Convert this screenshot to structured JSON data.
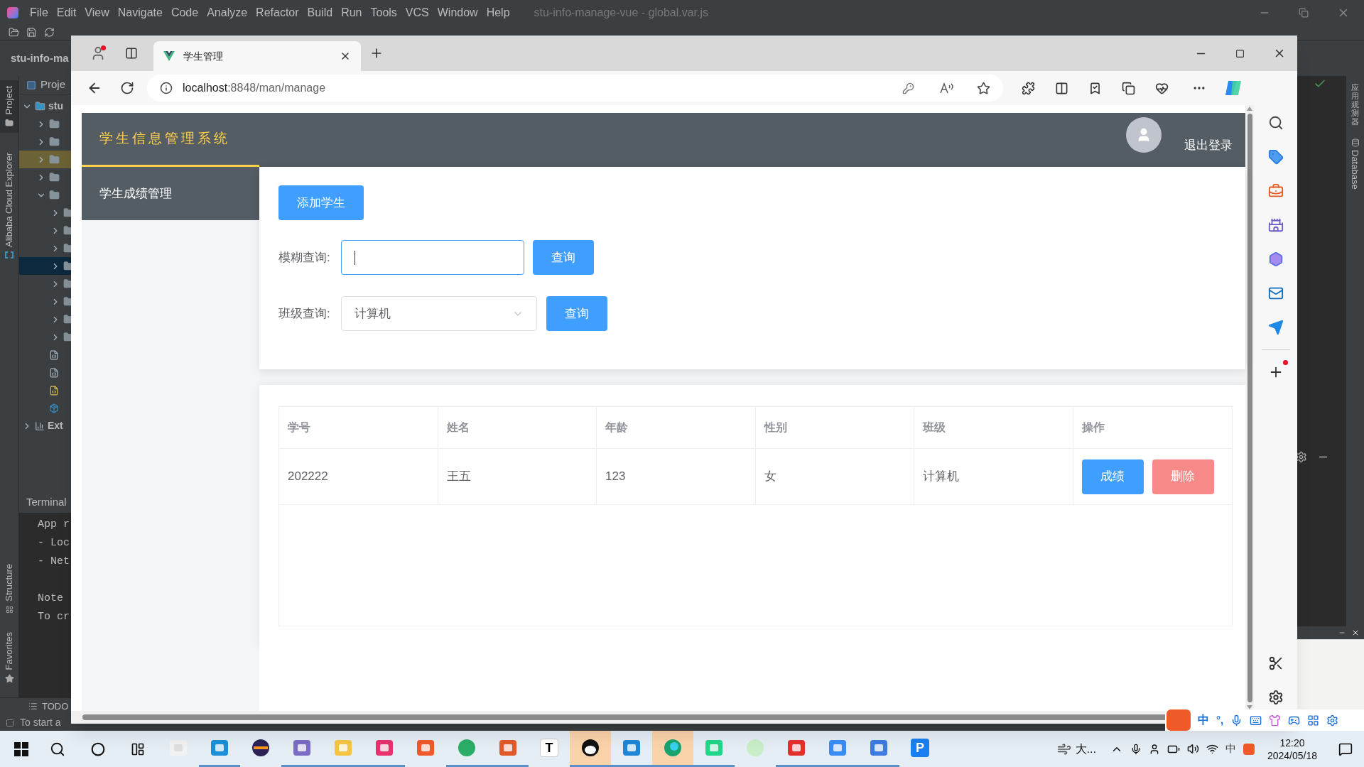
{
  "ide": {
    "menu": [
      "File",
      "Edit",
      "View",
      "Navigate",
      "Code",
      "Analyze",
      "Refactor",
      "Build",
      "Run",
      "Tools",
      "VCS",
      "Window",
      "Help"
    ],
    "title": "stu-info-manage-vue - global.var.js",
    "project_name": "stu-info-ma",
    "left_tools_top": [
      {
        "label": "Project",
        "selected": true
      },
      {
        "label": "Alibaba Cloud Explorer",
        "selected": false
      }
    ],
    "left_tools_bottom": [
      {
        "label": "Structure"
      },
      {
        "label": "Favorites"
      }
    ],
    "panel_title": "Proje",
    "tree": [
      {
        "label": "stu",
        "kind": "module",
        "expanded": true,
        "selected": false,
        "children": [
          {
            "kind": "folder",
            "expanded": false,
            "selected": false,
            "marked": false
          },
          {
            "kind": "folder",
            "expanded": false,
            "selected": false,
            "marked": false
          },
          {
            "kind": "folder",
            "expanded": false,
            "selected": false,
            "marked": true
          },
          {
            "kind": "folder",
            "expanded": false,
            "selected": false,
            "marked": false
          },
          {
            "kind": "folder",
            "expanded": true,
            "selected": false,
            "marked": false,
            "children": [
              {
                "kind": "folder",
                "expanded": false,
                "selected": false
              },
              {
                "kind": "folder",
                "expanded": false,
                "selected": false
              },
              {
                "kind": "folder",
                "expanded": false,
                "selected": false
              },
              {
                "kind": "folder",
                "expanded": false,
                "selected": true
              },
              {
                "kind": "folder",
                "expanded": false,
                "selected": false
              },
              {
                "kind": "folder",
                "expanded": false,
                "selected": false
              },
              {
                "kind": "folder",
                "expanded": false,
                "selected": false
              },
              {
                "kind": "folder",
                "expanded": false,
                "selected": false
              }
            ]
          },
          {
            "kind": "json",
            "selected": false
          },
          {
            "kind": "json",
            "selected": false
          },
          {
            "kind": "js",
            "selected": false
          },
          {
            "kind": "package",
            "selected": false
          }
        ]
      },
      {
        "label": "Ext",
        "kind": "libraries",
        "expanded": false,
        "selected": false
      }
    ],
    "terminal": {
      "title": "Terminal",
      "blocks": [
        [
          "App r",
          "- Loc",
          "- Net"
        ],
        [
          "Note",
          "To cr"
        ]
      ]
    },
    "bottom_tab": "TODO",
    "status": "To start a",
    "right_tools": [
      {
        "label": "应用观测器",
        "kind": "vertical-cjk"
      },
      {
        "label": "Database",
        "kind": "vertical"
      }
    ]
  },
  "browser": {
    "tab": {
      "title": "学生管理",
      "selected": true
    },
    "address": {
      "host": "localhost",
      "rest": ":8848/man/manage"
    },
    "page": {
      "app_title": "学生信息管理系统",
      "logout": "退出登录",
      "menu": [
        {
          "label": "学生成绩管理",
          "selected": true
        }
      ],
      "add_button": "添加学生",
      "fuzzy_search": {
        "label": "模糊查询:",
        "focused": true,
        "button": "查询"
      },
      "class_search": {
        "label": "班级查询:",
        "value": "计算机",
        "button": "查询"
      },
      "table": {
        "columns": [
          "学号",
          "姓名",
          "年龄",
          "性别",
          "班级",
          "操作"
        ],
        "rows": [
          {
            "cells": [
              "202222",
              "王五",
              "123",
              "女",
              "计算机"
            ],
            "actions": [
              {
                "label": "成绩",
                "kind": "primary"
              },
              {
                "label": "删除",
                "kind": "danger"
              }
            ]
          }
        ]
      }
    }
  },
  "sogou_bar": {
    "mode": "中",
    "punct": "°,"
  },
  "taskbar": {
    "apps": [
      {
        "kind": "file",
        "running": false,
        "selected": false
      },
      {
        "kind": "vmware",
        "running": true,
        "selected": false
      },
      {
        "kind": "eclipse",
        "running": false,
        "selected": false
      },
      {
        "kind": "dolphin",
        "running": true,
        "selected": false
      },
      {
        "kind": "folder",
        "running": true,
        "selected": false
      },
      {
        "kind": "idea",
        "running": true,
        "selected": false
      },
      {
        "kind": "player",
        "running": false,
        "selected": false
      },
      {
        "kind": "wechat",
        "running": true,
        "selected": false
      },
      {
        "kind": "slides",
        "running": true,
        "selected": false
      },
      {
        "kind": "letter",
        "glyph": "T",
        "running": false,
        "selected": false
      },
      {
        "kind": "qq",
        "running": true,
        "selected": true
      },
      {
        "kind": "vscode",
        "running": true,
        "selected": false
      },
      {
        "kind": "edge",
        "running": true,
        "selected": true
      },
      {
        "kind": "pycharm",
        "running": true,
        "selected": false
      },
      {
        "kind": "chat",
        "running": false,
        "selected": false
      },
      {
        "kind": "wps",
        "running": true,
        "selected": false
      },
      {
        "kind": "cloud",
        "running": true,
        "selected": false
      },
      {
        "kind": "books",
        "running": true,
        "selected": false
      },
      {
        "kind": "letter",
        "glyph": "P",
        "running": false,
        "selected": false
      }
    ],
    "weather": "大...",
    "ime": "中",
    "time": "12:20",
    "date": "2024/05/18"
  }
}
